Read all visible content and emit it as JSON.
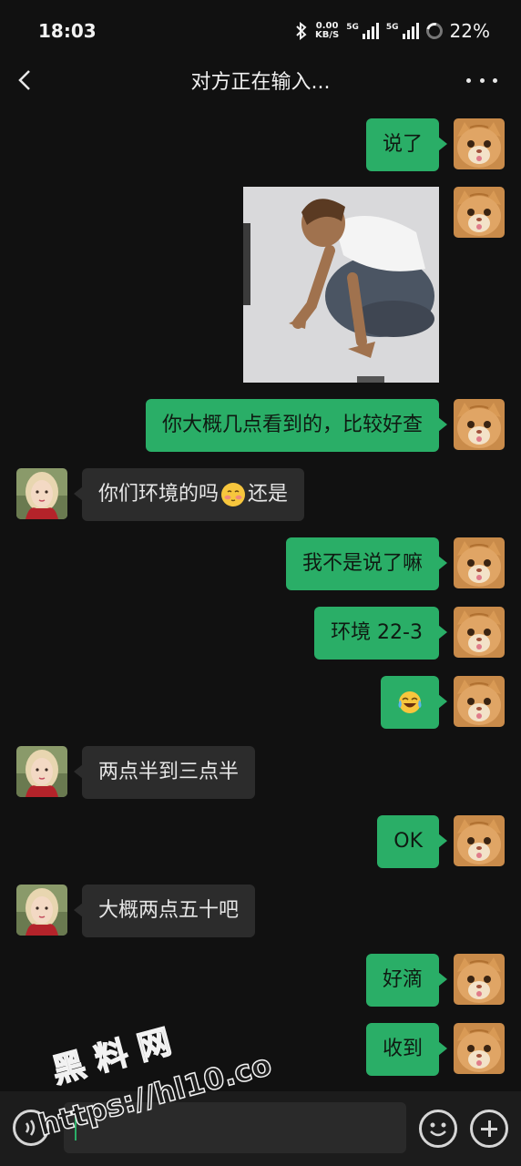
{
  "status_bar": {
    "time": "18:03",
    "net_speed_value": "0.00",
    "net_speed_unit": "KB/S",
    "sim1_label": "5G",
    "sim2_label": "5G",
    "battery": "22%"
  },
  "header": {
    "title": "对方正在输入..."
  },
  "messages": [
    {
      "side": "out",
      "type": "text",
      "text": "说了"
    },
    {
      "side": "out",
      "type": "image"
    },
    {
      "side": "out",
      "type": "text",
      "text": "你大概几点看到的，比较好查"
    },
    {
      "side": "in",
      "type": "text",
      "text_before": "你们环境的吗",
      "emoji": "shy-face-emoji",
      "text_after": "还是"
    },
    {
      "side": "out",
      "type": "text",
      "text": "我不是说了嘛"
    },
    {
      "side": "out",
      "type": "text",
      "text": "环境 22-3"
    },
    {
      "side": "out",
      "type": "emoji",
      "emoji": "tears-of-joy-emoji"
    },
    {
      "side": "in",
      "type": "text",
      "text": "两点半到三点半"
    },
    {
      "side": "out",
      "type": "text",
      "text": "OK"
    },
    {
      "side": "in",
      "type": "text",
      "text": "大概两点五十吧"
    },
    {
      "side": "out",
      "type": "text",
      "text": "好滴"
    },
    {
      "side": "out",
      "type": "text",
      "text": "收到"
    }
  ],
  "input": {
    "value": "",
    "placeholder": ""
  },
  "watermark": {
    "line1": "黑 料 网",
    "line2": "https://hl10.co"
  },
  "colors": {
    "background": "#111111",
    "outgoing_bubble": "#2aae67",
    "incoming_bubble": "#2c2c2c"
  },
  "icons": [
    "back-arrow-icon",
    "more-dots-icon",
    "voice-icon",
    "emoji-icon",
    "plus-icon",
    "bluetooth-icon",
    "signal-icon",
    "battery-icon"
  ]
}
